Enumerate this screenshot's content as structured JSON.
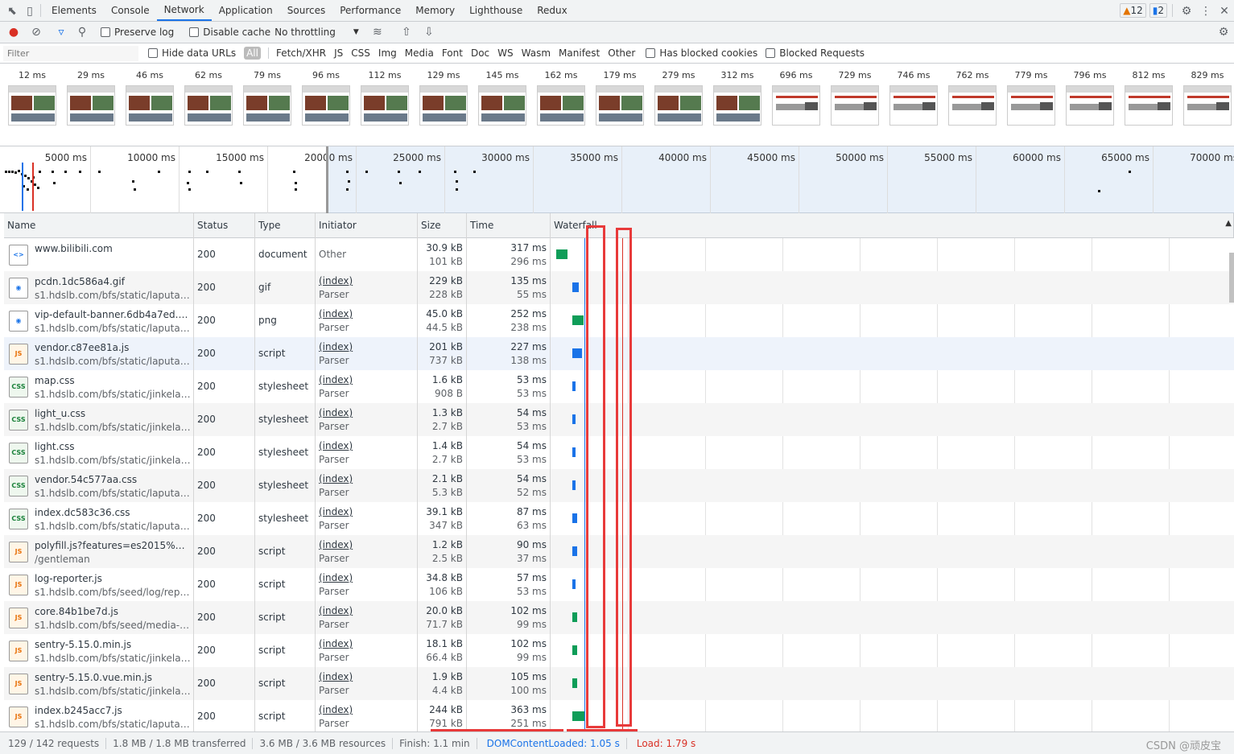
{
  "tabs": [
    "Elements",
    "Console",
    "Network",
    "Application",
    "Sources",
    "Performance",
    "Memory",
    "Lighthouse",
    "Redux"
  ],
  "badges": {
    "warnings": "12",
    "messages": "2"
  },
  "toolbar": {
    "preserve_log": "Preserve log",
    "disable_cache": "Disable cache",
    "throttling": "No throttling"
  },
  "filter": {
    "placeholder": "Filter",
    "hide_data_urls": "Hide data URLs",
    "types": [
      "All",
      "Fetch/XHR",
      "JS",
      "CSS",
      "Img",
      "Media",
      "Font",
      "Doc",
      "WS",
      "Wasm",
      "Manifest",
      "Other"
    ],
    "blocked_cookies": "Has blocked cookies",
    "blocked_requests": "Blocked Requests"
  },
  "filmstrip": [
    "12 ms",
    "29 ms",
    "46 ms",
    "62 ms",
    "79 ms",
    "96 ms",
    "112 ms",
    "129 ms",
    "145 ms",
    "162 ms",
    "179 ms",
    "279 ms",
    "312 ms",
    "696 ms",
    "729 ms",
    "746 ms",
    "762 ms",
    "779 ms",
    "796 ms",
    "812 ms",
    "829 ms"
  ],
  "overview_ticks": [
    "5000 ms",
    "10000 ms",
    "15000 ms",
    "20000 ms",
    "25000 ms",
    "30000 ms",
    "35000 ms",
    "40000 ms",
    "45000 ms",
    "50000 ms",
    "55000 ms",
    "60000 ms",
    "65000 ms",
    "70000 ms"
  ],
  "columns": [
    "Name",
    "Status",
    "Type",
    "Initiator",
    "Size",
    "Time",
    "Waterfall"
  ],
  "rows": [
    {
      "icon": "doc",
      "name": "www.bilibili.com",
      "path": "",
      "status": "200",
      "type": "document",
      "init1": "Other",
      "init2": "",
      "size1": "30.9 kB",
      "size2": "101 kB",
      "time1": "317 ms",
      "time2": "296 ms"
    },
    {
      "icon": "img",
      "name": "pcdn.1dc586a4.gif",
      "path": "s1.hdslb.com/bfs/static/laputa-ho...",
      "status": "200",
      "type": "gif",
      "init1": "(index)",
      "init2": "Parser",
      "size1": "229 kB",
      "size2": "228 kB",
      "time1": "135 ms",
      "time2": "55 ms"
    },
    {
      "icon": "img",
      "name": "vip-default-banner.6db4a7ed.png",
      "path": "s1.hdslb.com/bfs/static/laputa-ho...",
      "status": "200",
      "type": "png",
      "init1": "(index)",
      "init2": "Parser",
      "size1": "45.0 kB",
      "size2": "44.5 kB",
      "time1": "252 ms",
      "time2": "238 ms"
    },
    {
      "icon": "js",
      "name": "vendor.c87ee81a.js",
      "path": "s1.hdslb.com/bfs/static/laputa-ho...",
      "status": "200",
      "type": "script",
      "init1": "(index)",
      "init2": "Parser",
      "size1": "201 kB",
      "size2": "737 kB",
      "time1": "227 ms",
      "time2": "138 ms"
    },
    {
      "icon": "css",
      "name": "map.css",
      "path": "s1.hdslb.com/bfs/static/jinkela/lon...",
      "status": "200",
      "type": "stylesheet",
      "init1": "(index)",
      "init2": "Parser",
      "size1": "1.6 kB",
      "size2": "908 B",
      "time1": "53 ms",
      "time2": "53 ms"
    },
    {
      "icon": "css",
      "name": "light_u.css",
      "path": "s1.hdslb.com/bfs/static/jinkela/lon...",
      "status": "200",
      "type": "stylesheet",
      "init1": "(index)",
      "init2": "Parser",
      "size1": "1.3 kB",
      "size2": "2.7 kB",
      "time1": "54 ms",
      "time2": "53 ms"
    },
    {
      "icon": "css",
      "name": "light.css",
      "path": "s1.hdslb.com/bfs/static/jinkela/lon...",
      "status": "200",
      "type": "stylesheet",
      "init1": "(index)",
      "init2": "Parser",
      "size1": "1.4 kB",
      "size2": "2.7 kB",
      "time1": "54 ms",
      "time2": "53 ms"
    },
    {
      "icon": "css",
      "name": "vendor.54c577aa.css",
      "path": "s1.hdslb.com/bfs/static/laputa-ho...",
      "status": "200",
      "type": "stylesheet",
      "init1": "(index)",
      "init2": "Parser",
      "size1": "2.1 kB",
      "size2": "5.3 kB",
      "time1": "54 ms",
      "time2": "52 ms"
    },
    {
      "icon": "css",
      "name": "index.dc583c36.css",
      "path": "s1.hdslb.com/bfs/static/laputa-ho...",
      "status": "200",
      "type": "stylesheet",
      "init1": "(index)",
      "init2": "Parser",
      "size1": "39.1 kB",
      "size2": "347 kB",
      "time1": "87 ms",
      "time2": "63 ms"
    },
    {
      "icon": "js",
      "name": "polyfill.js?features=es2015%2Ces2...",
      "path": "/gentleman",
      "status": "200",
      "type": "script",
      "init1": "(index)",
      "init2": "Parser",
      "size1": "1.2 kB",
      "size2": "2.5 kB",
      "time1": "90 ms",
      "time2": "37 ms"
    },
    {
      "icon": "js",
      "name": "log-reporter.js",
      "path": "s1.hdslb.com/bfs/seed/log/report",
      "status": "200",
      "type": "script",
      "init1": "(index)",
      "init2": "Parser",
      "size1": "34.8 kB",
      "size2": "106 kB",
      "time1": "57 ms",
      "time2": "53 ms"
    },
    {
      "icon": "js",
      "name": "core.84b1be7d.js",
      "path": "s1.hdslb.com/bfs/seed/media-prev...",
      "status": "200",
      "type": "script",
      "init1": "(index)",
      "init2": "Parser",
      "size1": "20.0 kB",
      "size2": "71.7 kB",
      "time1": "102 ms",
      "time2": "99 ms"
    },
    {
      "icon": "js",
      "name": "sentry-5.15.0.min.js",
      "path": "s1.hdslb.com/bfs/static/jinkela/lon...",
      "status": "200",
      "type": "script",
      "init1": "(index)",
      "init2": "Parser",
      "size1": "18.1 kB",
      "size2": "66.4 kB",
      "time1": "102 ms",
      "time2": "99 ms"
    },
    {
      "icon": "js",
      "name": "sentry-5.15.0.vue.min.js",
      "path": "s1.hdslb.com/bfs/static/jinkela/lon...",
      "status": "200",
      "type": "script",
      "init1": "(index)",
      "init2": "Parser",
      "size1": "1.9 kB",
      "size2": "4.4 kB",
      "time1": "105 ms",
      "time2": "100 ms"
    },
    {
      "icon": "js",
      "name": "index.b245acc7.js",
      "path": "s1.hdslb.com/bfs/static/laputa-ho...",
      "status": "200",
      "type": "script",
      "init1": "(index)",
      "init2": "Parser",
      "size1": "244 kB",
      "size2": "791 kB",
      "time1": "363 ms",
      "time2": "251 ms"
    }
  ],
  "status": {
    "requests": "129 / 142 requests",
    "transferred": "1.8 MB / 1.8 MB transferred",
    "resources": "3.6 MB / 3.6 MB resources",
    "finish": "Finish: 1.1 min",
    "dcl": "DOMContentLoaded: 1.05 s",
    "load": "Load: 1.79 s",
    "watermark": "CSDN @顽皮宝"
  }
}
